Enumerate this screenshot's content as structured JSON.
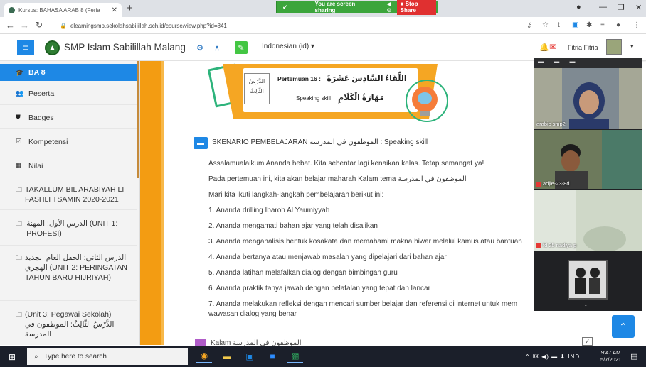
{
  "browser": {
    "tab_title": "Kursus: BAHASA ARAB 8 (Feria",
    "new_tab": "+",
    "sharing_text": "You are screen sharing",
    "stop_share": "Stop Share",
    "url": "elearningsmp.sekolahsabilillah.sch.id/course/view.php?id=841"
  },
  "navbar": {
    "site_name": "SMP Islam Sabilillah Malang",
    "language": "Indonesian (id) ▾",
    "user_name": "Fitria Fitria"
  },
  "sidebar": {
    "items": [
      {
        "label": "BA 8",
        "icon": "graduation-cap-icon",
        "glyph": "🎓"
      },
      {
        "label": "Peserta",
        "icon": "users-icon",
        "glyph": "👥"
      },
      {
        "label": "Badges",
        "icon": "shield-icon",
        "glyph": "⛊"
      },
      {
        "label": "Kompetensi",
        "icon": "check-square-icon",
        "glyph": "☑"
      },
      {
        "label": "Nilai",
        "icon": "table-icon",
        "glyph": "▦"
      },
      {
        "label": "TAKALLUM BIL ARABIYAH LI FASHLI TSAMIN 2020-2021",
        "icon": "folder-icon",
        "glyph": "🗀"
      },
      {
        "label": "الدرس الأول: المهنة (UNIT 1: PROFESI)",
        "icon": "folder-icon",
        "glyph": "🗀"
      },
      {
        "label": "الدرس الثاني: الحفل العام الجديد الهجري (UNIT 2: PERINGATAN TAHUN BARU HIJRIYAH)",
        "icon": "folder-icon",
        "glyph": "🗀"
      },
      {
        "label": "(Unit 3: Pegawai Sekolah) الدَّرْسُ الثَّالِثُ: الموظفون في المدرسة",
        "icon": "folder-icon",
        "glyph": "🗀"
      }
    ]
  },
  "banner": {
    "tag_line1": "الدَّرْسُ",
    "tag_line2": "الثَّالِثُ",
    "meeting_label": "Pertemuan 16 :",
    "meeting_arabic": "اللِّقَاءُ السَّادِسَ عَشَرَةَ",
    "skill_label": "Speaking skill",
    "skill_arabic": "مَهَارَةُ الْكَلَامِ"
  },
  "content": {
    "section_title": "SKENARIO PEMBELAJARAN الموظفون في المدرسة : Speaking skill",
    "lines": [
      "Assalamualaikum Ananda hebat. Kita sebentar lagi kenaikan kelas. Tetap semangat ya!",
      "Pada pertemuan ini, kita akan belajar maharah Kalam tema الموظفون في المدرسة",
      "Mari kita ikuti langkah-langkah pembelajaran berikut ini:",
      "1. Ananda drilling Ibaroh Al Yaumiyyah",
      "2. Ananda mengamati bahan ajar yang telah disajikan",
      "3. Ananda menganalisis bentuk kosakata dan memahami makna hiwar melalui kamus atau bantuan",
      "4. Ananda bertanya atau menjawab masalah yang dipelajari dari bahan ajar",
      "5. Ananda latihan melafalkan dialog dengan bimbingan guru",
      "6. Ananda praktik tanya jawab dengan pelafalan yang tepat dan lancar",
      "7. Ananda melakukan refleksi dengan mencari sumber belajar dan referensi di internet untuk mem",
      "wawasan dialog yang benar"
    ],
    "next_activity": "Kalam الموظفون في المدرسة"
  },
  "video_call": {
    "participants": [
      {
        "name": "arabic smp2",
        "muted": false
      },
      {
        "name": "adjie-23-8d",
        "muted": true
      },
      {
        "name": "fd 25 nadiya p",
        "muted": true
      }
    ]
  },
  "taskbar": {
    "search_placeholder": "Type here to search",
    "tray": "⌃ ㏍ ◀) ▬ ⬇ IND",
    "time": "9:47 AM",
    "date": "5/7/2021"
  },
  "colors": {
    "accent_blue": "#1e88e5",
    "orange": "#f39c12",
    "green": "#2db37b",
    "taskbar": "#1b1f2a"
  }
}
